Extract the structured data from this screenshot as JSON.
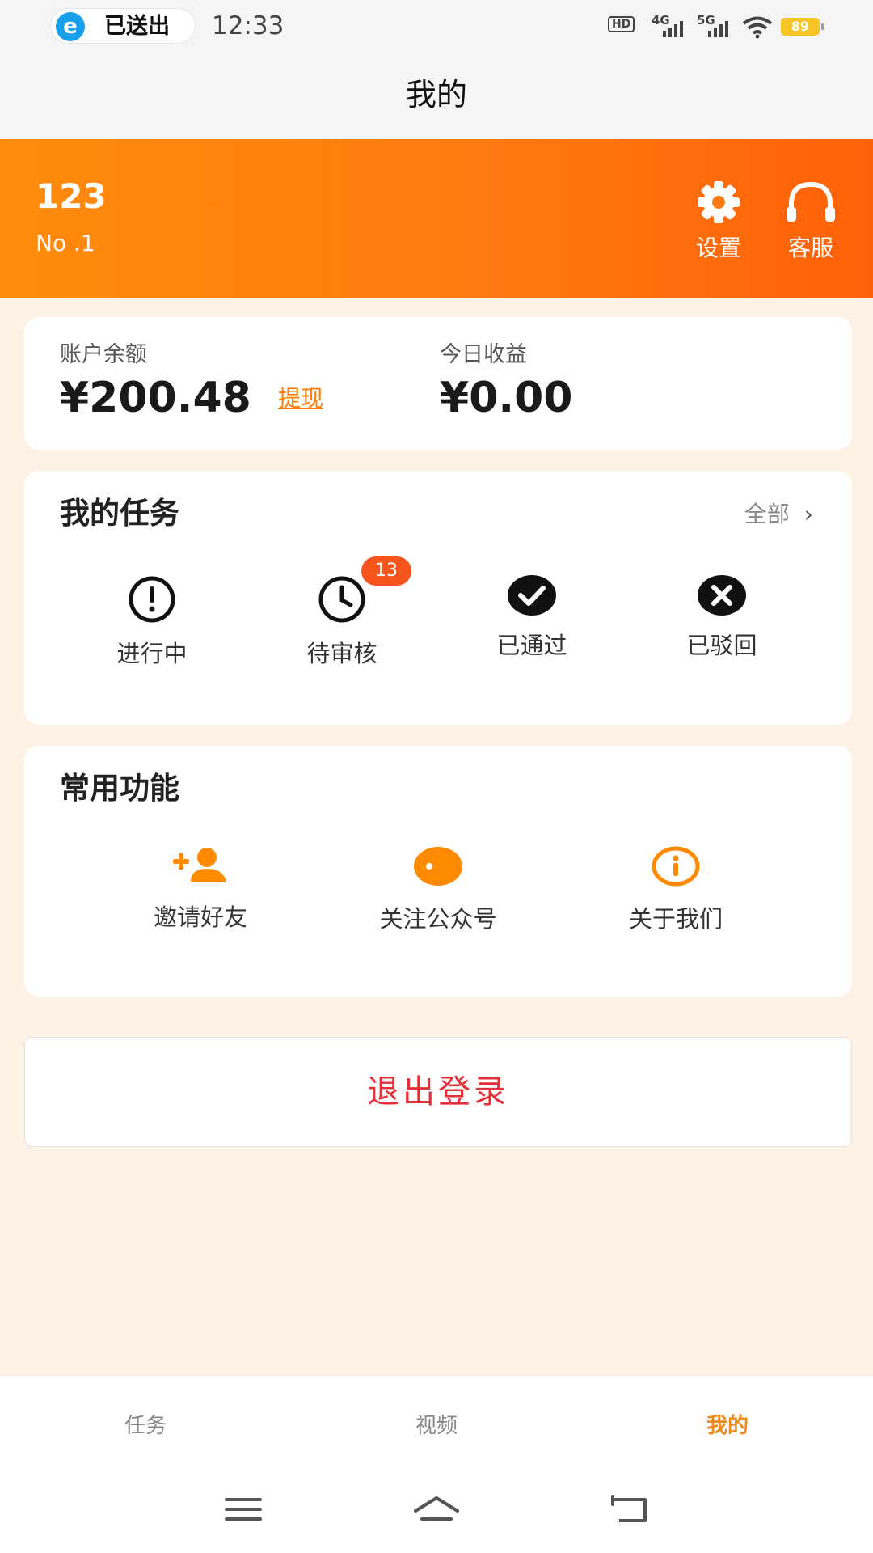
{
  "status_bar": {
    "sent_text": "已送出",
    "time": "12:33",
    "network_1": "4G",
    "network_2": "5G",
    "hd_label": "HD",
    "battery": "89"
  },
  "page_title": "我的",
  "user": {
    "name": "123",
    "rank": "No .1"
  },
  "header_actions": {
    "settings_label": "设置",
    "service_label": "客服"
  },
  "balance": {
    "account_label": "账户余额",
    "account_value": "¥200.48",
    "withdraw_label": "提现",
    "today_label": "今日收益",
    "today_value": "¥0.00"
  },
  "tasks": {
    "title": "我的任务",
    "see_all": "全部",
    "items": [
      {
        "label": "进行中",
        "icon": "exclamation-circle-icon"
      },
      {
        "label": "待审核",
        "icon": "clock-icon",
        "badge": "13"
      },
      {
        "label": "已通过",
        "icon": "check-circle-icon"
      },
      {
        "label": "已驳回",
        "icon": "x-circle-icon"
      }
    ]
  },
  "functions": {
    "title": "常用功能",
    "items": [
      {
        "label": "邀请好友",
        "icon": "add-user-icon"
      },
      {
        "label": "关注公众号",
        "icon": "follow-icon"
      },
      {
        "label": "关于我们",
        "icon": "info-icon"
      }
    ]
  },
  "logout_label": "退出登录",
  "tab_bar": {
    "tabs": [
      {
        "label": "任务",
        "active": false
      },
      {
        "label": "视频",
        "active": false
      },
      {
        "label": "我的",
        "active": true
      }
    ]
  },
  "colors": {
    "accent": "#ff7c00",
    "header_start": "#ff8b0c",
    "header_end": "#ff6108",
    "danger": "#e5303a",
    "badge": "#f5541c",
    "background": "#fdf2e4"
  }
}
